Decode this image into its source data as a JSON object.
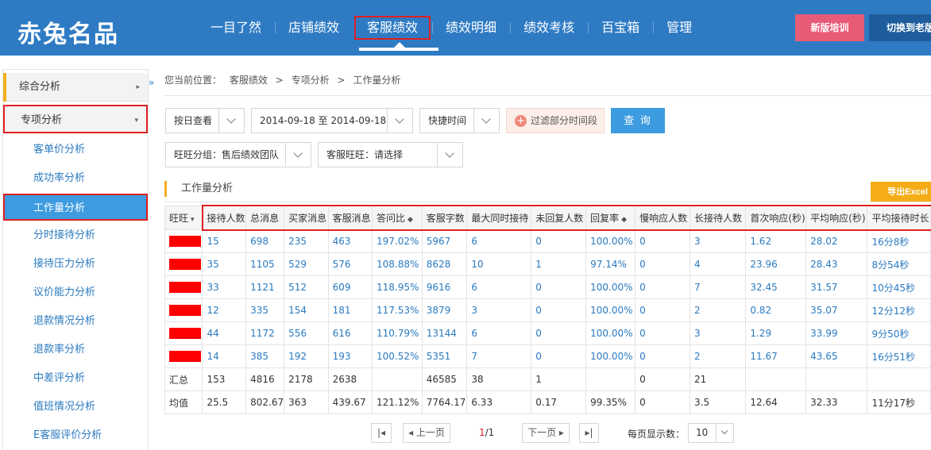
{
  "app": {
    "logo_text": "赤兔名品"
  },
  "nav": {
    "items": [
      "一目了然",
      "店铺绩效",
      "客服绩效",
      "绩效明细",
      "绩效考核",
      "百宝箱",
      "管理"
    ],
    "active": "客服绩效"
  },
  "header_buttons": {
    "training": "新版培训",
    "switch_old": "切换到老版"
  },
  "sidebar": {
    "groups": [
      {
        "label": "综合分析",
        "arrow": "▸"
      },
      {
        "label": "专项分析",
        "arrow": "▾"
      }
    ],
    "items": [
      "客单价分析",
      "成功率分析",
      "工作量分析",
      "分时接待分析",
      "接待压力分析",
      "议价能力分析",
      "退款情况分析",
      "退款率分析",
      "中差评分析",
      "值班情况分析",
      "E客服评价分析"
    ],
    "active_item": "工作量分析",
    "collapse_icon": "»"
  },
  "breadcrumb": {
    "prefix": "您当前位置：",
    "items": [
      "客服绩效",
      "专项分析",
      "工作量分析"
    ],
    "sep": ">"
  },
  "filters": {
    "view_mode": "按日查看",
    "date_range": "2014-09-18 至 2014-09-18",
    "quick_time": "快捷时间",
    "exclude_btn": "过滤部分时间段",
    "query_btn": "查 询",
    "group": "旺旺分组：售后绩效团队",
    "agent": "客服旺旺：请选择"
  },
  "section": {
    "title": "工作量分析",
    "export_btn": "导出Excel"
  },
  "table": {
    "headers": [
      "旺旺",
      "接待人数",
      "总消息",
      "买家消息",
      "客服消息",
      "答问比",
      "客服字数",
      "最大同时接待",
      "未回复人数",
      "回复率",
      "慢响应人数",
      "长接待人数",
      "首次响应(秒)",
      "平均响应(秒)",
      "平均接待时长"
    ],
    "sort_marks": {
      "0": "▾",
      "5": "◆",
      "9": "◆"
    },
    "rows": [
      [
        "15",
        "698",
        "235",
        "463",
        "197.02%",
        "5967",
        "6",
        "0",
        "100.00%",
        "0",
        "3",
        "1.62",
        "28.02",
        "16分8秒"
      ],
      [
        "35",
        "1105",
        "529",
        "576",
        "108.88%",
        "8628",
        "10",
        "1",
        "97.14%",
        "0",
        "4",
        "23.96",
        "28.43",
        "8分54秒"
      ],
      [
        "33",
        "1121",
        "512",
        "609",
        "118.95%",
        "9616",
        "6",
        "0",
        "100.00%",
        "0",
        "7",
        "32.45",
        "31.57",
        "10分45秒"
      ],
      [
        "12",
        "335",
        "154",
        "181",
        "117.53%",
        "3879",
        "3",
        "0",
        "100.00%",
        "0",
        "2",
        "0.82",
        "35.07",
        "12分12秒"
      ],
      [
        "44",
        "1172",
        "556",
        "616",
        "110.79%",
        "13144",
        "6",
        "0",
        "100.00%",
        "0",
        "3",
        "1.29",
        "33.99",
        "9分50秒"
      ],
      [
        "14",
        "385",
        "192",
        "193",
        "100.52%",
        "5351",
        "7",
        "0",
        "100.00%",
        "0",
        "2",
        "11.67",
        "43.65",
        "16分51秒"
      ]
    ],
    "summary": [
      "汇总",
      "153",
      "4816",
      "2178",
      "2638",
      "",
      "46585",
      "38",
      "1",
      "",
      "0",
      "21",
      "",
      "",
      ""
    ],
    "average": [
      "均值",
      "25.5",
      "802.67",
      "363",
      "439.67",
      "121.12%",
      "7764.17",
      "6.33",
      "0.17",
      "99.35%",
      "0",
      "3.5",
      "12.64",
      "32.33",
      "11分17秒"
    ]
  },
  "pager": {
    "first": "|◂",
    "prev": "◂ 上一页",
    "current": "1",
    "total": "/1",
    "next": "下一页 ▸",
    "last": "▸|",
    "size_label": "每页显示数：",
    "size_value": "10"
  },
  "colors": {
    "brand": "#2e7bc4",
    "accent_orange": "#f5ad17",
    "highlight_red": "#e02020",
    "link_blue": "#2a7ac0"
  }
}
